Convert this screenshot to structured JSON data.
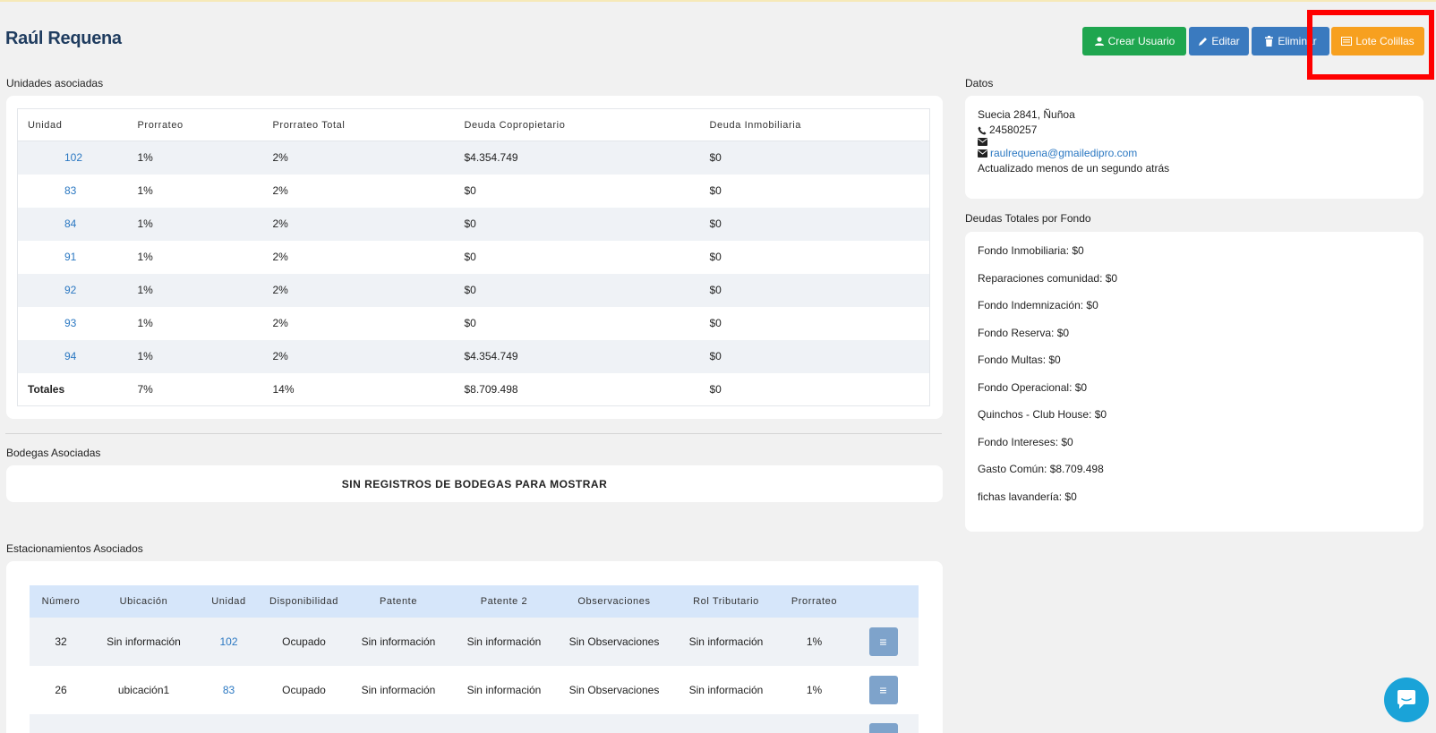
{
  "header": {
    "title": "Raúl Requena",
    "buttons": {
      "crear_usuario": "Crear Usuario",
      "editar": "Editar",
      "eliminar": "Eliminar",
      "lote_colillas": "Lote Colillas"
    }
  },
  "unidades": {
    "label": "Unidades asociadas",
    "columns": [
      "Unidad",
      "Prorrateo",
      "Prorrateo Total",
      "Deuda Copropietario",
      "Deuda Inmobiliaria"
    ],
    "rows": [
      {
        "unidad": "102",
        "prorrateo": "1%",
        "total": "2%",
        "deuda_cop": "$4.354.749",
        "deuda_inm": "$0"
      },
      {
        "unidad": "83",
        "prorrateo": "1%",
        "total": "2%",
        "deuda_cop": "$0",
        "deuda_inm": "$0"
      },
      {
        "unidad": "84",
        "prorrateo": "1%",
        "total": "2%",
        "deuda_cop": "$0",
        "deuda_inm": "$0"
      },
      {
        "unidad": "91",
        "prorrateo": "1%",
        "total": "2%",
        "deuda_cop": "$0",
        "deuda_inm": "$0"
      },
      {
        "unidad": "92",
        "prorrateo": "1%",
        "total": "2%",
        "deuda_cop": "$0",
        "deuda_inm": "$0"
      },
      {
        "unidad": "93",
        "prorrateo": "1%",
        "total": "2%",
        "deuda_cop": "$0",
        "deuda_inm": "$0"
      },
      {
        "unidad": "94",
        "prorrateo": "1%",
        "total": "2%",
        "deuda_cop": "$4.354.749",
        "deuda_inm": "$0"
      }
    ],
    "totals": {
      "label": "Totales",
      "prorrateo": "7%",
      "total": "14%",
      "deuda_cop": "$8.709.498",
      "deuda_inm": "$0"
    }
  },
  "bodegas": {
    "label": "Bodegas Asociadas",
    "empty": "SIN REGISTROS DE BODEGAS PARA MOSTRAR"
  },
  "estacionamientos": {
    "label": "Estacionamientos Asociados",
    "columns": [
      "Número",
      "Ubicación",
      "Unidad",
      "Disponibilidad",
      "Patente",
      "Patente 2",
      "Observaciones",
      "Rol Tributario",
      "Prorrateo",
      ""
    ],
    "rows": [
      {
        "numero": "32",
        "ubicacion": "Sin información",
        "unidad": "102",
        "disponibilidad": "Ocupado",
        "patente": "Sin información",
        "patente2": "Sin información",
        "observaciones": "Sin Observaciones",
        "rol": "Sin información",
        "prorrateo": "1%"
      },
      {
        "numero": "26",
        "ubicacion": "ubicación1",
        "unidad": "83",
        "disponibilidad": "Ocupado",
        "patente": "Sin información",
        "patente2": "Sin información",
        "observaciones": "Sin Observaciones",
        "rol": "Sin información",
        "prorrateo": "1%"
      }
    ]
  },
  "datos": {
    "label": "Datos",
    "address": "Suecia 2841, Ñuñoa",
    "phone": "24580257",
    "email": "raulrequena@gmailedipro.com",
    "updated": "Actualizado menos de un segundo atrás"
  },
  "deudas": {
    "label": "Deudas Totales por Fondo",
    "items": [
      "Fondo Inmobiliaria: $0",
      "Reparaciones comunidad: $0",
      "Fondo Indemnización: $0",
      "Fondo Reserva: $0",
      "Fondo Multas: $0",
      "Fondo Operacional: $0",
      "Quinchos - Club House: $0",
      "Fondo Intereses: $0",
      "Gasto Común: $8.709.498",
      "fichas lavandería: $0"
    ]
  },
  "colors": {
    "green": "#1fa64f",
    "blue": "#3a7abf",
    "orange": "#f7a01f",
    "link": "#2b78c2",
    "highlight": "#ff0000"
  }
}
